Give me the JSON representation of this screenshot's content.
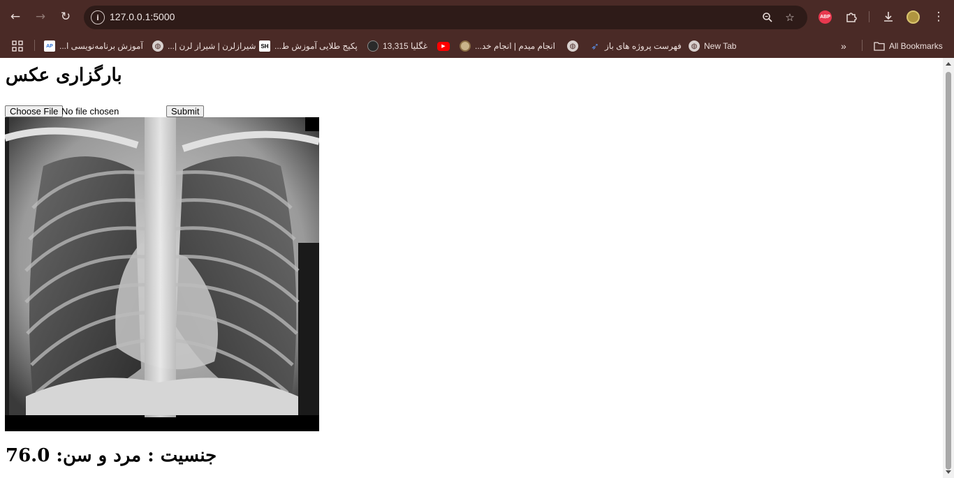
{
  "browser": {
    "url": "127.0.0.1:5000",
    "extension_abp_label": "ABP",
    "bookmarks": [
      {
        "label": "آموزش برنامه‌نویسی ا...",
        "icon": "blue-logo-icon"
      },
      {
        "label": "شیرازلرن | شیراز لرن |...",
        "icon": "globe-icon"
      },
      {
        "label": "پکیج طلایی آموزش ط...",
        "icon": "sh-logo-icon"
      },
      {
        "label": "غگلیا 13,315",
        "icon": "dark-circle-icon"
      },
      {
        "label": "",
        "icon": "youtube-icon"
      },
      {
        "label": "انجام میدم | انجام خد...",
        "icon": "coin-icon"
      },
      {
        "label": "فهرست پروژه های باز",
        "icon": "globe-icon"
      },
      {
        "label": "",
        "icon": "arrow-logo-icon"
      },
      {
        "label": "New Tab",
        "icon": "globe-icon"
      }
    ],
    "all_bookmarks_label": "All Bookmarks"
  },
  "page": {
    "title": "بارگزاری عکس",
    "choose_file_label": "Choose File",
    "file_status": "No file chosen",
    "submit_label": "Submit",
    "result_text": "جنسیت : مرد و سن: 76.0"
  }
}
